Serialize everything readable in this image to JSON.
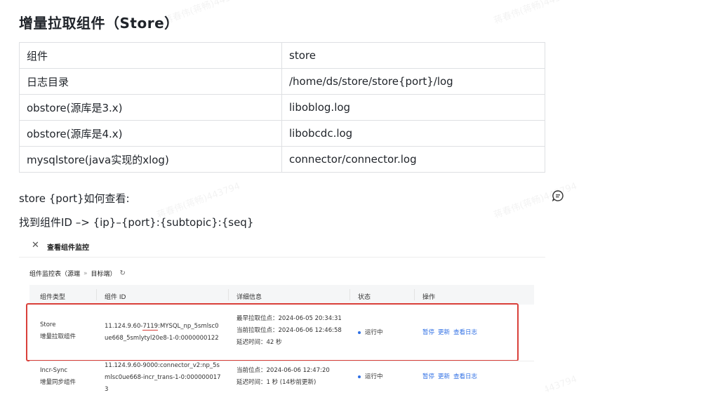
{
  "title": "增量拉取组件（Store）",
  "kv_table": [
    [
      "组件",
      "store"
    ],
    [
      "日志目录",
      "/home/ds/store/store{port}/log"
    ],
    [
      "obstore(源库是3.x)",
      "liboblog.log"
    ],
    [
      "obstore(源库是4.x)",
      "libobcdc.log"
    ],
    [
      "mysqlstore(java实现的xlog)",
      "connector/connector.log"
    ]
  ],
  "para1": "store {port}如何查看:",
  "para2": "找到组件ID –> {ip}–{port}:{subtopic}:{seq}",
  "watermark": "蒋春伟(蒋畅)443794",
  "screenshot": {
    "close_icon": "close-icon",
    "panel_title": "查看组件监控",
    "crumb_1": "组件监控表（源端",
    "crumb_sep": "»",
    "crumb_2": "目标端）",
    "headers": [
      "组件类型",
      "组件 ID",
      "详细信息",
      "状态",
      "操作"
    ],
    "row1": {
      "type_line1": "Store",
      "type_line2": "增量拉取组件",
      "id_prefix": "11.124.9.60-",
      "id_port": "7119",
      "id_rest1": ":MYSQL_np_5smlsc0",
      "id_line2": "ue668_5smlytyl20e8-1-0:0000000122",
      "detail1": "最早拉取位点：2024-06-05 20:34:31",
      "detail2": "当前拉取位点：2024-06-06 12:46:58",
      "detail3": "延迟时间：42 秒",
      "status": "运行中",
      "ops": [
        "暂停",
        "更新",
        "查看日志"
      ]
    },
    "row2": {
      "type_line1": "Incr-Sync",
      "type_line2": "增量同步组件",
      "id_line1": "11.124.9.60-9000:connector_v2:np_5s",
      "id_line2": "mlsc0ue668-incr_trans-1-0:000000017",
      "id_line3": "3",
      "detail1": "当前位点：2024-06-06 12:47:20",
      "detail2": "延迟时间：1 秒 (14秒前更新)",
      "status": "运行中",
      "ops": [
        "暂停",
        "更新",
        "查看日志"
      ]
    }
  }
}
